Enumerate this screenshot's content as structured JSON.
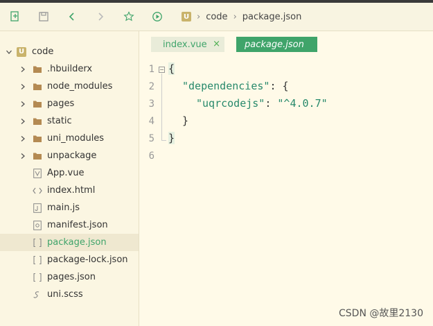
{
  "breadcrumb": {
    "project": "code",
    "file": "package.json",
    "logo": "U"
  },
  "sidebar": {
    "root": {
      "label": "code",
      "logo": "U"
    },
    "items": [
      {
        "label": ".hbuilderx",
        "icon": "folder-icon"
      },
      {
        "label": "node_modules",
        "icon": "folder-icon"
      },
      {
        "label": "pages",
        "icon": "folder-icon"
      },
      {
        "label": "static",
        "icon": "folder-icon"
      },
      {
        "label": "uni_modules",
        "icon": "folder-icon"
      },
      {
        "label": "unpackage",
        "icon": "folder-icon"
      },
      {
        "label": "App.vue",
        "icon": "vue-file-icon"
      },
      {
        "label": "index.html",
        "icon": "html-file-icon"
      },
      {
        "label": "main.js",
        "icon": "js-file-icon"
      },
      {
        "label": "manifest.json",
        "icon": "manifest-file-icon"
      },
      {
        "label": "package.json",
        "icon": "json-file-icon",
        "selected": true
      },
      {
        "label": "package-lock.json",
        "icon": "json-file-icon"
      },
      {
        "label": "pages.json",
        "icon": "json-file-icon"
      },
      {
        "label": "uni.scss",
        "icon": "scss-file-icon"
      }
    ]
  },
  "tabs": [
    {
      "label": "index.vue",
      "close": "×"
    },
    {
      "label": "package.json",
      "active": true
    }
  ],
  "editor": {
    "line_numbers": [
      "1",
      "2",
      "3",
      "4",
      "5",
      "6"
    ],
    "code": {
      "l1": "{",
      "l2_key": "\"dependencies\"",
      "l2_rest": ": {",
      "l3_key": "\"uqrcodejs\"",
      "l3_colon": ": ",
      "l3_val": "\"^4.0.7\"",
      "l4": "}",
      "l5": "}"
    },
    "fold_marker": "−"
  },
  "watermark": "CSDN @故里2130",
  "colors": {
    "accent": "#3fa46a",
    "background": "#fffae8",
    "sidebar": "#fbf6e2"
  }
}
